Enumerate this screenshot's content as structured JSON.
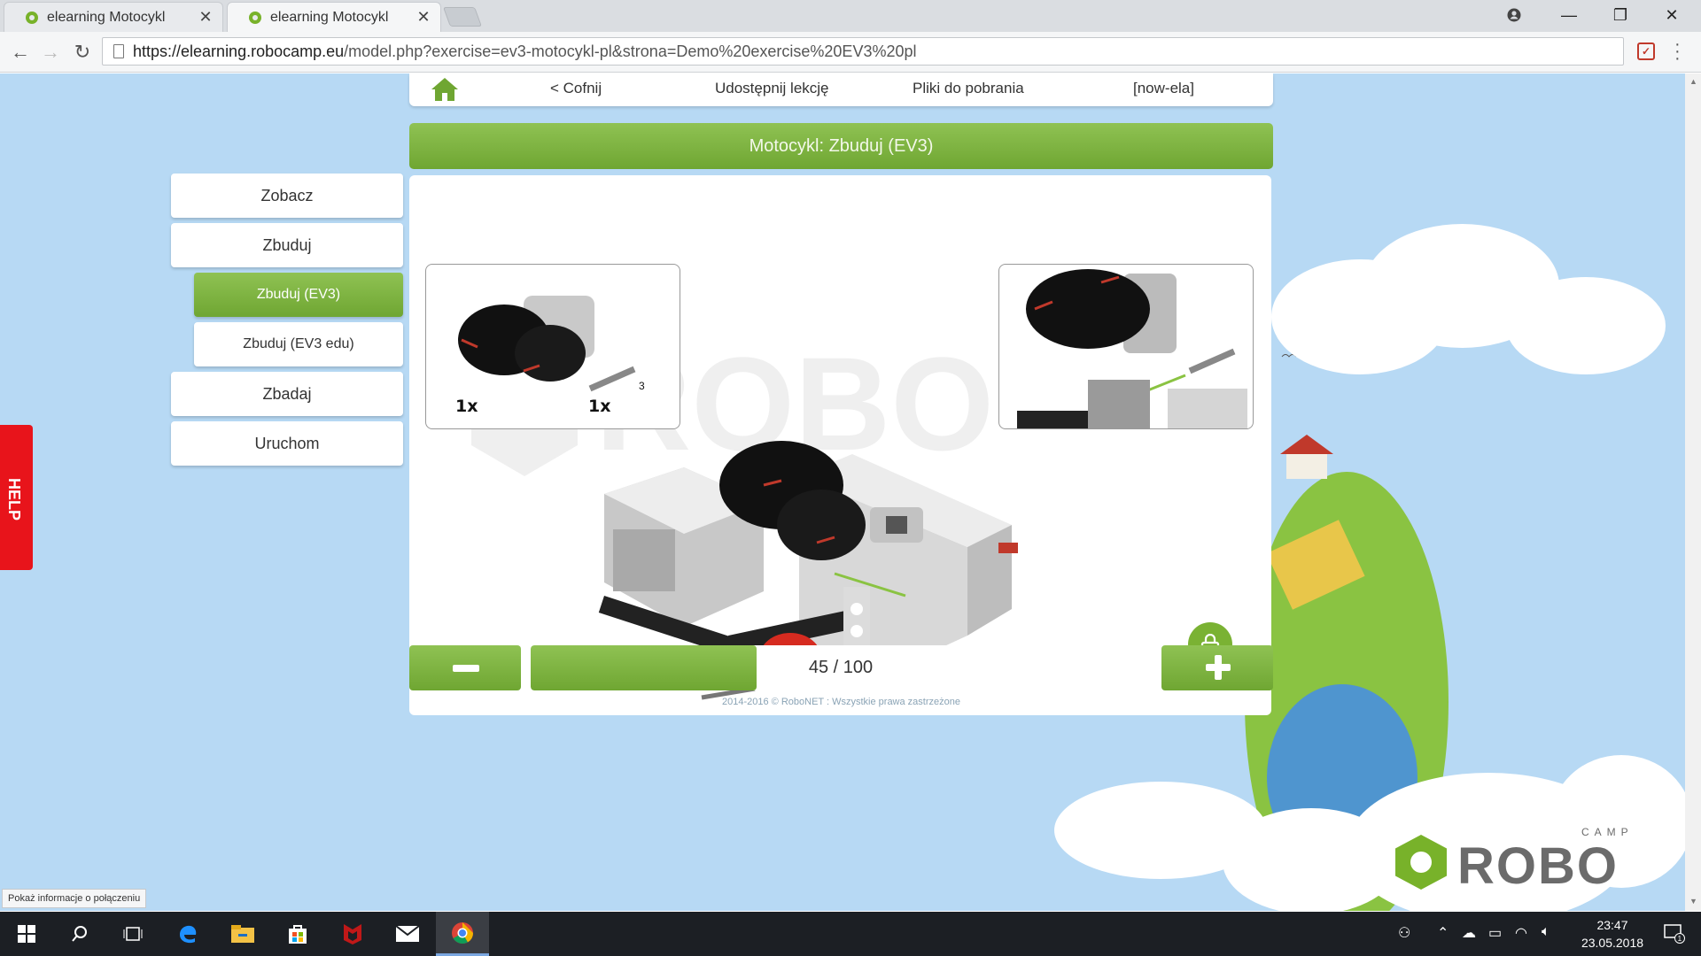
{
  "browser": {
    "tabs": [
      {
        "title": "elearning Motocykl"
      },
      {
        "title": "elearning Motocykl"
      }
    ],
    "url_host": "https://elearning.robocamp.eu",
    "url_path": "/model.php?exercise=ev3-motocykl-pl&strona=Demo%20exercise%20EV3%20pl",
    "status": "Pokaż informacje o połączeniu"
  },
  "nav": {
    "back": "< Cofnij",
    "share": "Udostępnij lekcję",
    "downloads": "Pliki do pobrania",
    "user": "[now-ela]"
  },
  "header": {
    "title": "Motocykl: Zbuduj (EV3)"
  },
  "sidebar": {
    "items": [
      {
        "label": "Zobacz"
      },
      {
        "label": "Zbuduj"
      },
      {
        "label": "Zbuduj (EV3)"
      },
      {
        "label": "Zbuduj (EV3 edu)"
      },
      {
        "label": "Zbadaj"
      },
      {
        "label": "Uruchom"
      }
    ]
  },
  "help": {
    "label": "HELP"
  },
  "parts": {
    "qty1": "1x",
    "qty2": "1x",
    "axle_len": "3"
  },
  "progress": {
    "current": 45,
    "total": 100,
    "label": "45 / 100",
    "fraction": 0.45
  },
  "footer": {
    "copyright": "2014-2016 © RoboNET : Wszystkie prawa zastrzeżone"
  },
  "logo": {
    "text": "ROBO",
    "camp": "CAMP"
  },
  "taskbar": {
    "time": "23:47",
    "date": "23.05.2018",
    "notif": "1"
  },
  "colors": {
    "accent": "#7ab233",
    "help": "#e8141b",
    "sky": "#b7d9f4"
  }
}
